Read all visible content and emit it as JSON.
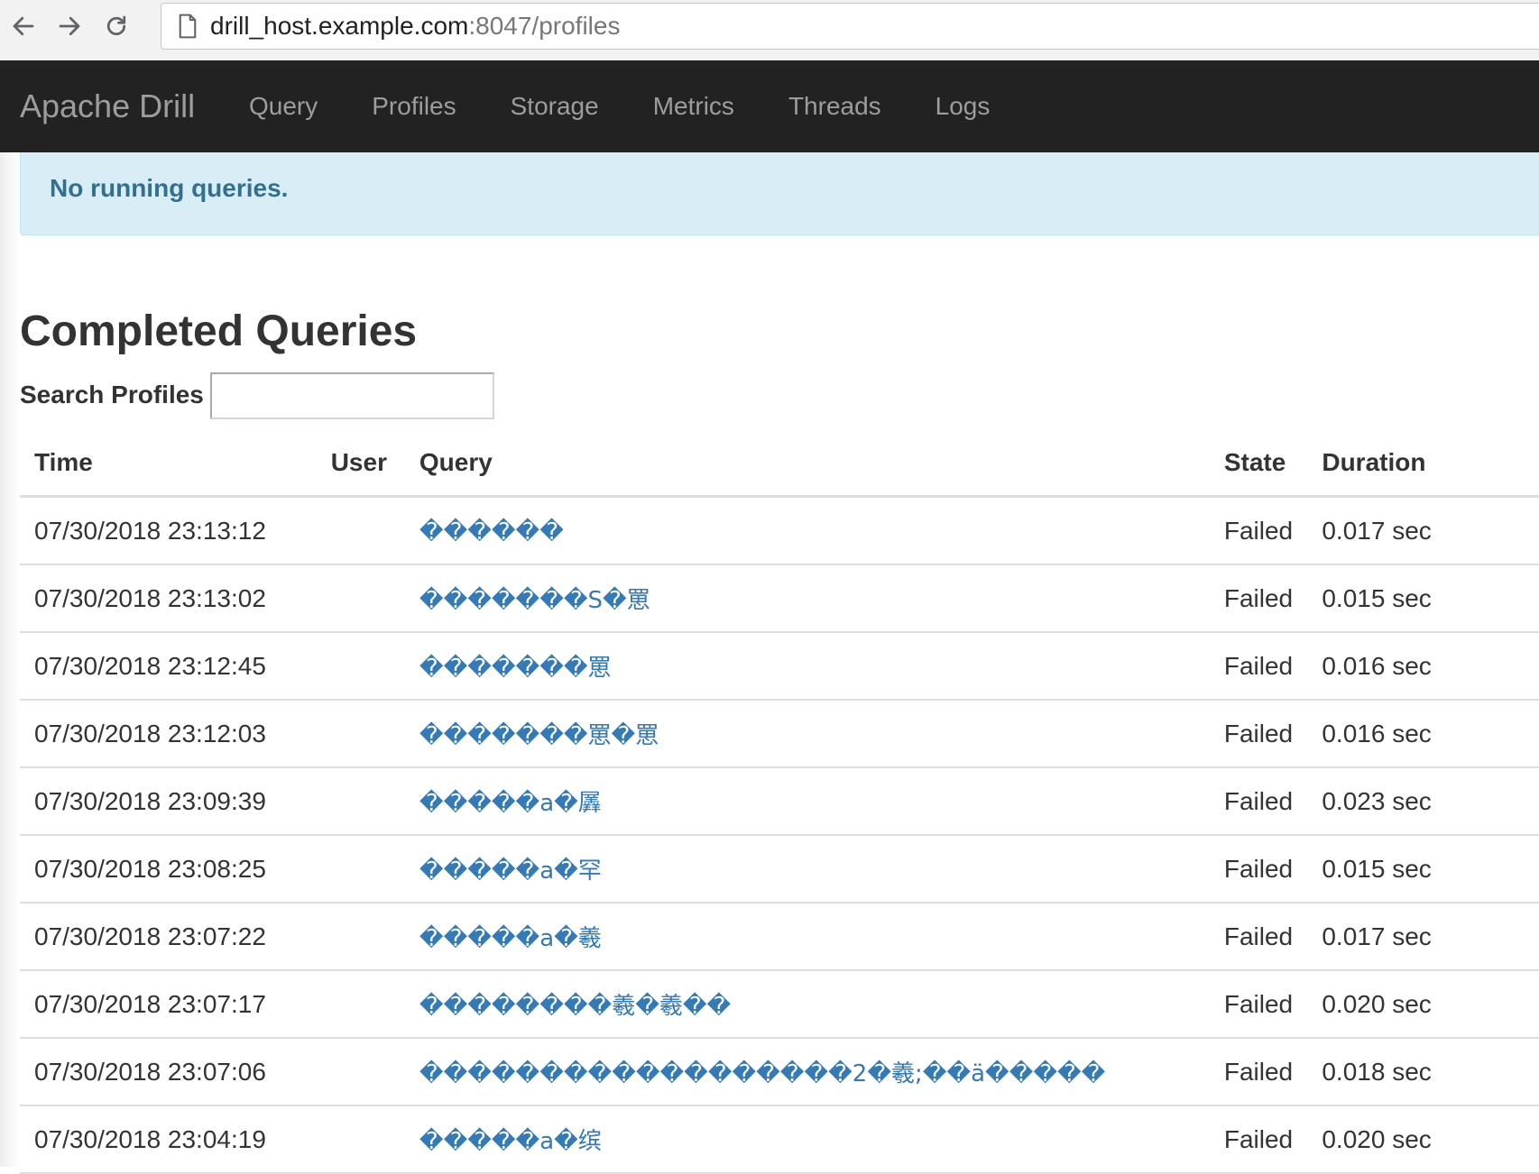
{
  "browser": {
    "url_host": "drill_host.example.com",
    "url_rest": ":8047/profiles"
  },
  "navbar": {
    "brand": "Apache Drill",
    "links": [
      "Query",
      "Profiles",
      "Storage",
      "Metrics",
      "Threads",
      "Logs"
    ]
  },
  "alert": {
    "text": "No running queries."
  },
  "main": {
    "title": "Completed Queries",
    "search_label": "Search Profiles",
    "search_value": "",
    "table": {
      "headers": [
        "Time",
        "User",
        "Query",
        "State",
        "Duration"
      ],
      "rows": [
        {
          "time": "07/30/2018 23:13:12",
          "user": "",
          "query": "������",
          "state": "Failed",
          "duration": "0.017 sec"
        },
        {
          "time": "07/30/2018 23:13:02",
          "user": "",
          "query": "�������S�罳",
          "state": "Failed",
          "duration": "0.015 sec"
        },
        {
          "time": "07/30/2018 23:12:45",
          "user": "",
          "query": "�������罳",
          "state": "Failed",
          "duration": "0.016 sec"
        },
        {
          "time": "07/30/2018 23:12:03",
          "user": "",
          "query": "�������罳�罳",
          "state": "Failed",
          "duration": "0.016 sec"
        },
        {
          "time": "07/30/2018 23:09:39",
          "user": "",
          "query": "�����a�羼",
          "state": "Failed",
          "duration": "0.023 sec"
        },
        {
          "time": "07/30/2018 23:08:25",
          "user": "",
          "query": "�����a�罕",
          "state": "Failed",
          "duration": "0.015 sec"
        },
        {
          "time": "07/30/2018 23:07:22",
          "user": "",
          "query": "�����a�羲",
          "state": "Failed",
          "duration": "0.017 sec"
        },
        {
          "time": "07/30/2018 23:07:17",
          "user": "",
          "query": "��������羲�羲��",
          "state": "Failed",
          "duration": "0.020 sec"
        },
        {
          "time": "07/30/2018 23:07:06",
          "user": "",
          "query": "������������������2�羲;��ä�����",
          "state": "Failed",
          "duration": "0.018 sec"
        },
        {
          "time": "07/30/2018 23:04:19",
          "user": "",
          "query": "�����a�缤",
          "state": "Failed",
          "duration": "0.020 sec"
        }
      ]
    }
  },
  "icons": {
    "back": "back-arrow-icon",
    "forward": "forward-arrow-icon",
    "reload": "reload-icon",
    "page": "page-icon"
  },
  "colors": {
    "navbar_bg": "#222222",
    "navbar_text": "#9d9d9d",
    "alert_bg": "#d9edf7",
    "alert_text": "#31708f",
    "link": "#337ab7"
  }
}
